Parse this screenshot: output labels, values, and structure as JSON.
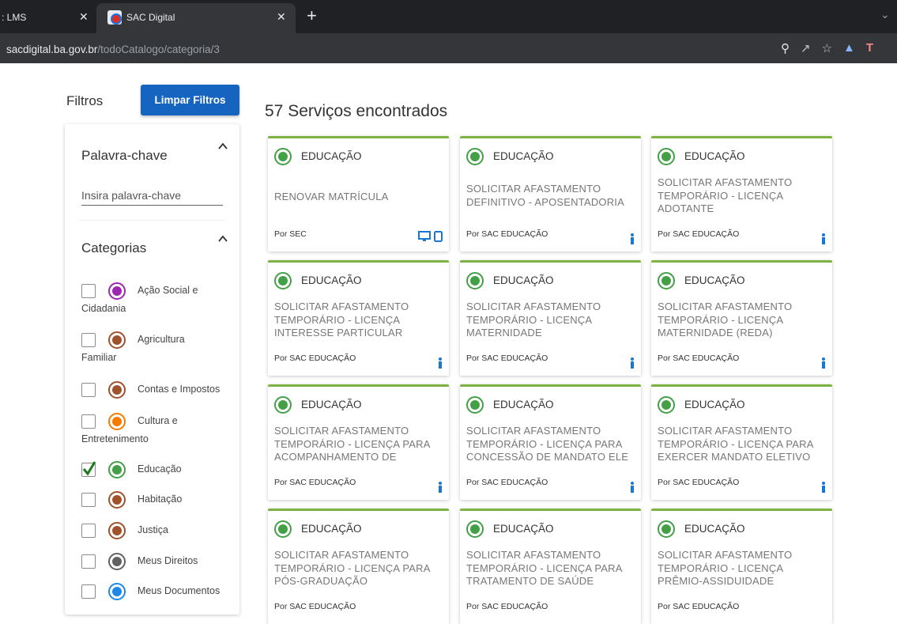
{
  "browser": {
    "tabs": [
      {
        "title": ": LMS",
        "active": false
      },
      {
        "title": "SAC Digital",
        "active": true
      }
    ],
    "new_tab_symbol": "+",
    "close_symbol": "✕",
    "url_host": "sacdigital.ba.gov.br",
    "url_path": "/todoCatalogo/categoria/3",
    "toolbar_icons": [
      "key-icon",
      "share-icon",
      "bookmark-star-icon",
      "extension-icon",
      "profile-icon"
    ]
  },
  "filters": {
    "label": "Filtros",
    "clear_button": "Limpar Filtros",
    "keyword_title": "Palavra-chave",
    "keyword_placeholder": "Insira palavra-chave",
    "categories_title": "Categorias",
    "categories": [
      {
        "line1": "Ação Social e",
        "line2": "Cidadania",
        "checked": false,
        "icon": "people-icon",
        "color": "#9c27b0"
      },
      {
        "line1": "Agricultura",
        "line2": "Familiar",
        "checked": false,
        "icon": "family-icon",
        "color": "#a0522d"
      },
      {
        "line1": "Contas e Impostos",
        "line2": "",
        "checked": false,
        "icon": "family-icon",
        "color": "#a0522d"
      },
      {
        "line1": "Cultura e",
        "line2": "Entretenimento",
        "checked": false,
        "icon": "culture-icon",
        "color": "#f57c00"
      },
      {
        "line1": "Educação",
        "line2": "",
        "checked": true,
        "icon": "graduation-cap-icon",
        "color": "#43a047"
      },
      {
        "line1": "Habitação",
        "line2": "",
        "checked": false,
        "icon": "family-icon",
        "color": "#a0522d"
      },
      {
        "line1": "Justiça",
        "line2": "",
        "checked": false,
        "icon": "family-icon",
        "color": "#a0522d"
      },
      {
        "line1": "Meus Direitos",
        "line2": "",
        "checked": false,
        "icon": "scales-icon",
        "color": "#616161"
      },
      {
        "line1": "Meus Documentos",
        "line2": "",
        "checked": false,
        "icon": "document-icon",
        "color": "#1e88e5"
      }
    ]
  },
  "results": {
    "title": "57 Serviços encontrados",
    "cards": [
      {
        "category": "EDUCAÇÃO",
        "title": "RENOVAR MATRÍCULA",
        "org": "Por SEC",
        "channels": "online-devices"
      },
      {
        "category": "EDUCAÇÃO",
        "title": "SOLICITAR AFASTAMENTO DEFINITIVO - APOSENTADORIA",
        "org": "Por SAC EDUCAÇÃO",
        "channels": "in-person"
      },
      {
        "category": "EDUCAÇÃO",
        "title": "SOLICITAR AFASTAMENTO TEMPORÁRIO - LICENÇA ADOTANTE",
        "org": "Por SAC EDUCAÇÃO",
        "channels": "in-person"
      },
      {
        "category": "EDUCAÇÃO",
        "title": "SOLICITAR AFASTAMENTO TEMPORÁRIO - LICENÇA INTERESSE PARTICULAR",
        "org": "Por SAC EDUCAÇÃO",
        "channels": "in-person"
      },
      {
        "category": "EDUCAÇÃO",
        "title": "SOLICITAR AFASTAMENTO TEMPORÁRIO - LICENÇA MATERNIDADE",
        "org": "Por SAC EDUCAÇÃO",
        "channels": "in-person"
      },
      {
        "category": "EDUCAÇÃO",
        "title": "SOLICITAR AFASTAMENTO TEMPORÁRIO - LICENÇA MATERNIDADE (REDA)",
        "org": "Por SAC EDUCAÇÃO",
        "channels": "in-person"
      },
      {
        "category": "EDUCAÇÃO",
        "title": "SOLICITAR AFASTAMENTO TEMPORÁRIO - LICENÇA PARA ACOMPANHAMENTO DE FAMILIAR",
        "org": "Por SAC EDUCAÇÃO",
        "channels": "in-person"
      },
      {
        "category": "EDUCAÇÃO",
        "title": "SOLICITAR AFASTAMENTO TEMPORÁRIO - LICENÇA PARA CONCESSÃO DE MANDATO ELE",
        "org": "Por SAC EDUCAÇÃO",
        "channels": "in-person"
      },
      {
        "category": "EDUCAÇÃO",
        "title": "SOLICITAR AFASTAMENTO TEMPORÁRIO - LICENÇA PARA EXERCER MANDATO ELETIVO",
        "org": "Por SAC EDUCAÇÃO",
        "channels": "in-person"
      },
      {
        "category": "EDUCAÇÃO",
        "title": "SOLICITAR AFASTAMENTO TEMPORÁRIO - LICENÇA PARA PÓS-GRADUAÇÃO",
        "org": "Por SAC EDUCAÇÃO",
        "channels": "in-person"
      },
      {
        "category": "EDUCAÇÃO",
        "title": "SOLICITAR AFASTAMENTO TEMPORÁRIO - LICENÇA PARA TRATAMENTO DE SAÚDE",
        "org": "Por SAC EDUCAÇÃO",
        "channels": "in-person"
      },
      {
        "category": "EDUCAÇÃO",
        "title": "SOLICITAR AFASTAMENTO TEMPORÁRIO - LICENÇA PRÊMIO-ASSIDUIDADE",
        "org": "Por SAC EDUCAÇÃO",
        "channels": "in-person"
      }
    ]
  },
  "colors": {
    "accent_green": "#7cb342",
    "button_blue": "#1565c0",
    "channel_blue": "#1976d2"
  }
}
